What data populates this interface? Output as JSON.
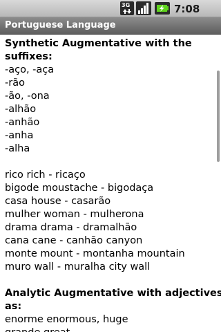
{
  "status_bar": {
    "network_label": "3G",
    "time": "7:08 PM",
    "icons": [
      "3g-data-icon",
      "signal-strength-icon",
      "battery-charging-icon"
    ]
  },
  "app": {
    "title": "Portuguese Language"
  },
  "content": {
    "synthetic": {
      "heading_line1": "Synthetic Augmentative with the",
      "heading_line2": "suffixes:",
      "suffixes": [
        "-aço, -aça",
        "-rão",
        "-ão, -ona",
        "-alhão",
        "-anhão",
        "-anha",
        "-alha"
      ],
      "examples": [
        "rico rich - ricaço",
        "bigode moustache - bigodaça",
        "casa house - casarão",
        "mulher woman - mulherona",
        "drama drama - dramalhão",
        "cana cane - canhão canyon",
        "monte mount - montanha mountain",
        "muro wall - muralha city wall"
      ]
    },
    "analytic": {
      "heading_line1": "Analytic Augmentative with adjectives",
      "heading_line2": "as:",
      "examples": [
        "enorme enormous, huge",
        "grande great"
      ]
    }
  },
  "colors": {
    "status_bar": "#c8c8c8",
    "title_bar": "#707070",
    "title_text": "#ffffff",
    "body_text": "#000000",
    "battery_accent": "#5fd41c"
  }
}
